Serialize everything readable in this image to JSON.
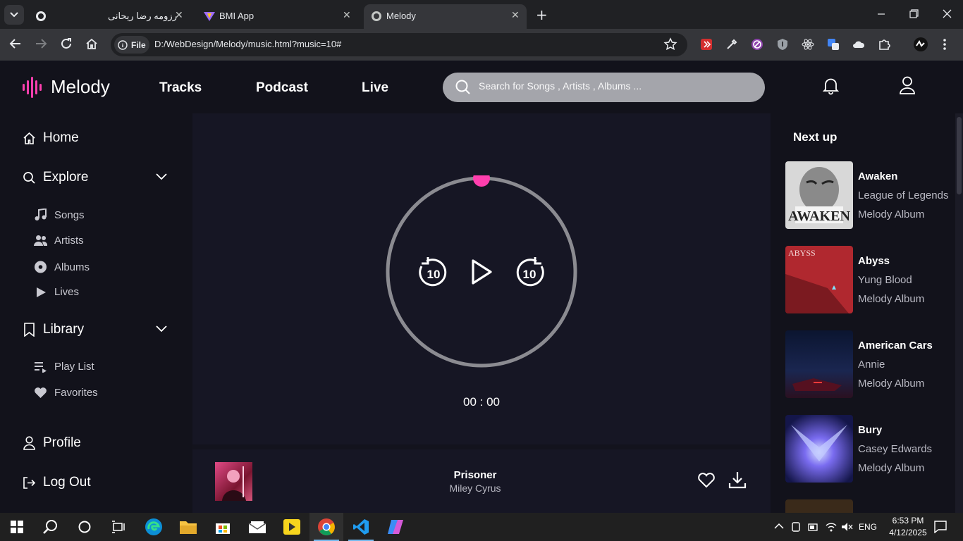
{
  "browser": {
    "tabs": [
      {
        "title": "رزومه رضا ریحانی",
        "active": false
      },
      {
        "title": "BMI App",
        "active": false
      },
      {
        "title": "Melody",
        "active": true
      }
    ],
    "file_chip": "File",
    "url": "D:/WebDesign/Melody/music.html?music=10#"
  },
  "header": {
    "logo": "Melody",
    "nav": [
      "Tracks",
      "Podcast",
      "Live"
    ],
    "search_placeholder": "Search for Songs , Artists , Albums ..."
  },
  "sidebar": {
    "home": "Home",
    "explore": "Explore",
    "explore_items": [
      "Songs",
      "Artists",
      "Albums",
      "Lives"
    ],
    "library": "Library",
    "library_items": [
      "Play List",
      "Favorites"
    ],
    "profile": "Profile",
    "logout": "Log Out"
  },
  "player": {
    "rewind_label": "10",
    "forward_label": "10",
    "time": "00 : 00",
    "progress": 0
  },
  "now_playing": {
    "title": "Prisoner",
    "artist": "Miley Cyrus"
  },
  "next_up": {
    "title": "Next up",
    "items": [
      {
        "name": "Awaken",
        "artist": "League of Legends",
        "album": "Melody Album"
      },
      {
        "name": "Abyss",
        "artist": "Yung Blood",
        "album": "Melody Album"
      },
      {
        "name": "American Cars",
        "artist": "Annie",
        "album": "Melody Album"
      },
      {
        "name": "Bury",
        "artist": "Casey Edwards",
        "album": "Melody Album"
      }
    ]
  },
  "taskbar": {
    "lang": "ENG",
    "time": "6:53 PM",
    "date": "4/12/2025"
  },
  "colors": {
    "accent": "#ff3fae",
    "background": "#13131d",
    "panel": "#161624",
    "sidebar": "#12121b",
    "search": "#a4a5ab"
  }
}
